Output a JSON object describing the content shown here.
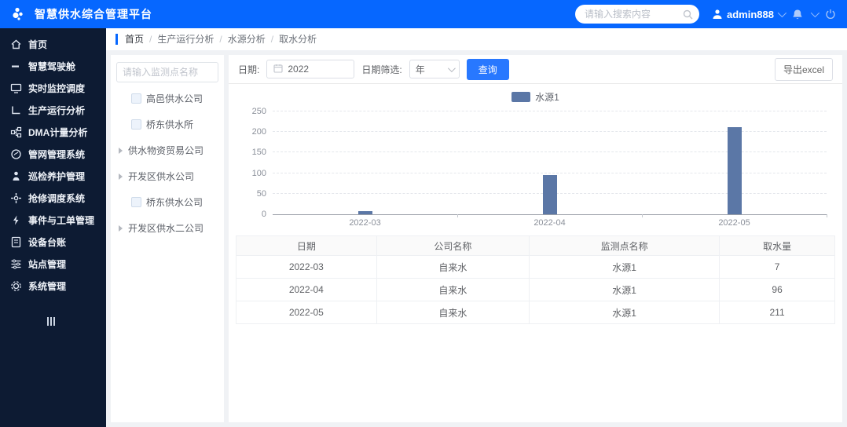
{
  "app": {
    "title": "智慧供水综合管理平台"
  },
  "header": {
    "search_placeholder": "请输入搜索内容",
    "username": "admin888",
    "icons": [
      "logo-icon",
      "search-icon",
      "user-icon",
      "chevron-down-icon",
      "bell-icon",
      "chevron-down-icon",
      "power-icon"
    ]
  },
  "sidebar": {
    "items": [
      {
        "label": "首页",
        "icon": "home-icon"
      },
      {
        "label": "智慧驾驶舱",
        "icon": "cockpit-icon"
      },
      {
        "label": "实时监控调度",
        "icon": "monitor-icon"
      },
      {
        "label": "生产运行分析",
        "icon": "analysis-icon"
      },
      {
        "label": "DMA计量分析",
        "icon": "dma-icon"
      },
      {
        "label": "管网管理系统",
        "icon": "pipe-network-icon"
      },
      {
        "label": "巡检养护管理",
        "icon": "patrol-icon"
      },
      {
        "label": "抢修调度系统",
        "icon": "repair-icon"
      },
      {
        "label": "事件与工单管理",
        "icon": "event-order-icon"
      },
      {
        "label": "设备台账",
        "icon": "ledger-icon"
      },
      {
        "label": "站点管理",
        "icon": "site-icon"
      },
      {
        "label": "系统管理",
        "icon": "gear-icon"
      }
    ],
    "collapse_icon": "collapse-icon"
  },
  "breadcrumb": {
    "separator": "/",
    "items": [
      "首页",
      "生产运行分析",
      "水源分析",
      "取水分析"
    ]
  },
  "tree_panel": {
    "search_placeholder": "请输入监测点名称",
    "items": [
      {
        "label": "高邑供水公司",
        "type": "checkbox"
      },
      {
        "label": "桥东供水所",
        "type": "checkbox"
      },
      {
        "label": "供水物资贸易公司",
        "type": "expand"
      },
      {
        "label": "开发区供水公司",
        "type": "expand"
      },
      {
        "label": "桥东供水公司",
        "type": "checkbox"
      },
      {
        "label": "开发区供水二公司",
        "type": "expand"
      }
    ]
  },
  "filters": {
    "date_label": "日期:",
    "date_value": "2022",
    "date_filter_label": "日期筛选:",
    "date_filter_value": "年",
    "query_button": "查询",
    "export_button": "导出excel"
  },
  "chart_data": {
    "type": "bar",
    "title": "",
    "legend_entries": [
      "水源1"
    ],
    "legend_position": "top",
    "categories": [
      "2022-03",
      "2022-04",
      "2022-05"
    ],
    "series": [
      {
        "name": "水源1",
        "values": [
          7,
          96,
          211
        ]
      }
    ],
    "xlabel": "",
    "ylabel": "",
    "ylim": [
      0,
      250
    ],
    "yticks": [
      0,
      50,
      100,
      150,
      200,
      250
    ],
    "grid": true,
    "bar_color": "#5b77a6"
  },
  "table": {
    "headers": [
      "日期",
      "公司名称",
      "监测点名称",
      "取水量"
    ],
    "rows": [
      [
        "2022-03",
        "自来水",
        "水源1",
        "7"
      ],
      [
        "2022-04",
        "自来水",
        "水源1",
        "96"
      ],
      [
        "2022-05",
        "自来水",
        "水源1",
        "211"
      ]
    ]
  },
  "colors": {
    "accent": "#0667ff",
    "sidebar_bg": "#0d1b33",
    "bar": "#5b77a6",
    "primary_button": "#2878ff"
  }
}
